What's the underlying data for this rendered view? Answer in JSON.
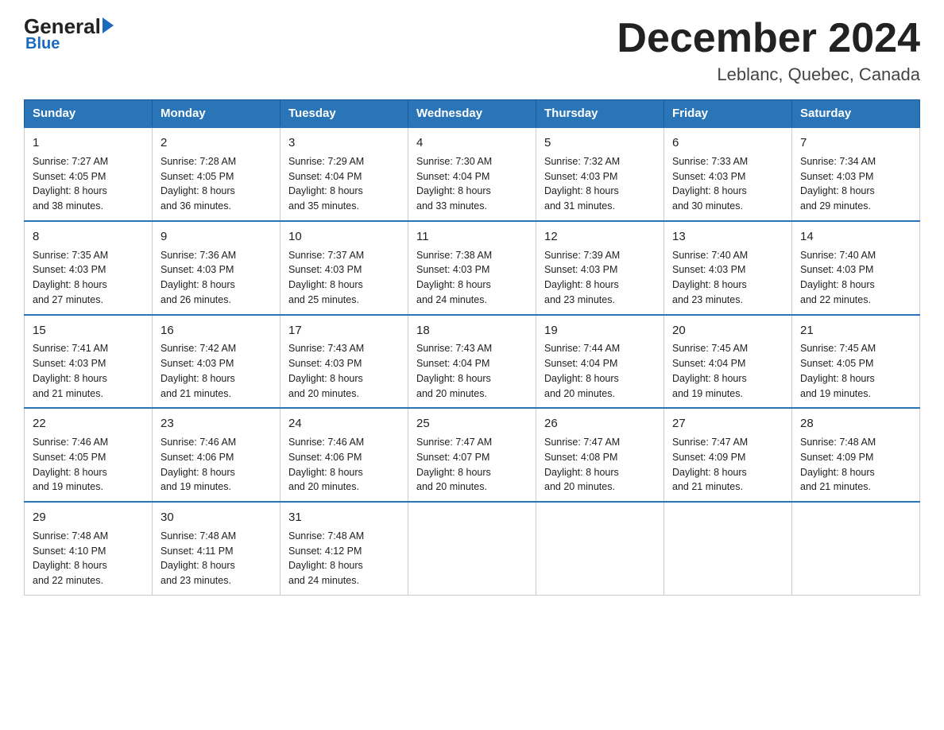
{
  "logo": {
    "general": "General",
    "blue": "Blue"
  },
  "title": "December 2024",
  "location": "Leblanc, Quebec, Canada",
  "days_header": [
    "Sunday",
    "Monday",
    "Tuesday",
    "Wednesday",
    "Thursday",
    "Friday",
    "Saturday"
  ],
  "weeks": [
    [
      {
        "num": "1",
        "info": "Sunrise: 7:27 AM\nSunset: 4:05 PM\nDaylight: 8 hours\nand 38 minutes."
      },
      {
        "num": "2",
        "info": "Sunrise: 7:28 AM\nSunset: 4:05 PM\nDaylight: 8 hours\nand 36 minutes."
      },
      {
        "num": "3",
        "info": "Sunrise: 7:29 AM\nSunset: 4:04 PM\nDaylight: 8 hours\nand 35 minutes."
      },
      {
        "num": "4",
        "info": "Sunrise: 7:30 AM\nSunset: 4:04 PM\nDaylight: 8 hours\nand 33 minutes."
      },
      {
        "num": "5",
        "info": "Sunrise: 7:32 AM\nSunset: 4:03 PM\nDaylight: 8 hours\nand 31 minutes."
      },
      {
        "num": "6",
        "info": "Sunrise: 7:33 AM\nSunset: 4:03 PM\nDaylight: 8 hours\nand 30 minutes."
      },
      {
        "num": "7",
        "info": "Sunrise: 7:34 AM\nSunset: 4:03 PM\nDaylight: 8 hours\nand 29 minutes."
      }
    ],
    [
      {
        "num": "8",
        "info": "Sunrise: 7:35 AM\nSunset: 4:03 PM\nDaylight: 8 hours\nand 27 minutes."
      },
      {
        "num": "9",
        "info": "Sunrise: 7:36 AM\nSunset: 4:03 PM\nDaylight: 8 hours\nand 26 minutes."
      },
      {
        "num": "10",
        "info": "Sunrise: 7:37 AM\nSunset: 4:03 PM\nDaylight: 8 hours\nand 25 minutes."
      },
      {
        "num": "11",
        "info": "Sunrise: 7:38 AM\nSunset: 4:03 PM\nDaylight: 8 hours\nand 24 minutes."
      },
      {
        "num": "12",
        "info": "Sunrise: 7:39 AM\nSunset: 4:03 PM\nDaylight: 8 hours\nand 23 minutes."
      },
      {
        "num": "13",
        "info": "Sunrise: 7:40 AM\nSunset: 4:03 PM\nDaylight: 8 hours\nand 23 minutes."
      },
      {
        "num": "14",
        "info": "Sunrise: 7:40 AM\nSunset: 4:03 PM\nDaylight: 8 hours\nand 22 minutes."
      }
    ],
    [
      {
        "num": "15",
        "info": "Sunrise: 7:41 AM\nSunset: 4:03 PM\nDaylight: 8 hours\nand 21 minutes."
      },
      {
        "num": "16",
        "info": "Sunrise: 7:42 AM\nSunset: 4:03 PM\nDaylight: 8 hours\nand 21 minutes."
      },
      {
        "num": "17",
        "info": "Sunrise: 7:43 AM\nSunset: 4:03 PM\nDaylight: 8 hours\nand 20 minutes."
      },
      {
        "num": "18",
        "info": "Sunrise: 7:43 AM\nSunset: 4:04 PM\nDaylight: 8 hours\nand 20 minutes."
      },
      {
        "num": "19",
        "info": "Sunrise: 7:44 AM\nSunset: 4:04 PM\nDaylight: 8 hours\nand 20 minutes."
      },
      {
        "num": "20",
        "info": "Sunrise: 7:45 AM\nSunset: 4:04 PM\nDaylight: 8 hours\nand 19 minutes."
      },
      {
        "num": "21",
        "info": "Sunrise: 7:45 AM\nSunset: 4:05 PM\nDaylight: 8 hours\nand 19 minutes."
      }
    ],
    [
      {
        "num": "22",
        "info": "Sunrise: 7:46 AM\nSunset: 4:05 PM\nDaylight: 8 hours\nand 19 minutes."
      },
      {
        "num": "23",
        "info": "Sunrise: 7:46 AM\nSunset: 4:06 PM\nDaylight: 8 hours\nand 19 minutes."
      },
      {
        "num": "24",
        "info": "Sunrise: 7:46 AM\nSunset: 4:06 PM\nDaylight: 8 hours\nand 20 minutes."
      },
      {
        "num": "25",
        "info": "Sunrise: 7:47 AM\nSunset: 4:07 PM\nDaylight: 8 hours\nand 20 minutes."
      },
      {
        "num": "26",
        "info": "Sunrise: 7:47 AM\nSunset: 4:08 PM\nDaylight: 8 hours\nand 20 minutes."
      },
      {
        "num": "27",
        "info": "Sunrise: 7:47 AM\nSunset: 4:09 PM\nDaylight: 8 hours\nand 21 minutes."
      },
      {
        "num": "28",
        "info": "Sunrise: 7:48 AM\nSunset: 4:09 PM\nDaylight: 8 hours\nand 21 minutes."
      }
    ],
    [
      {
        "num": "29",
        "info": "Sunrise: 7:48 AM\nSunset: 4:10 PM\nDaylight: 8 hours\nand 22 minutes."
      },
      {
        "num": "30",
        "info": "Sunrise: 7:48 AM\nSunset: 4:11 PM\nDaylight: 8 hours\nand 23 minutes."
      },
      {
        "num": "31",
        "info": "Sunrise: 7:48 AM\nSunset: 4:12 PM\nDaylight: 8 hours\nand 24 minutes."
      },
      {
        "num": "",
        "info": ""
      },
      {
        "num": "",
        "info": ""
      },
      {
        "num": "",
        "info": ""
      },
      {
        "num": "",
        "info": ""
      }
    ]
  ]
}
